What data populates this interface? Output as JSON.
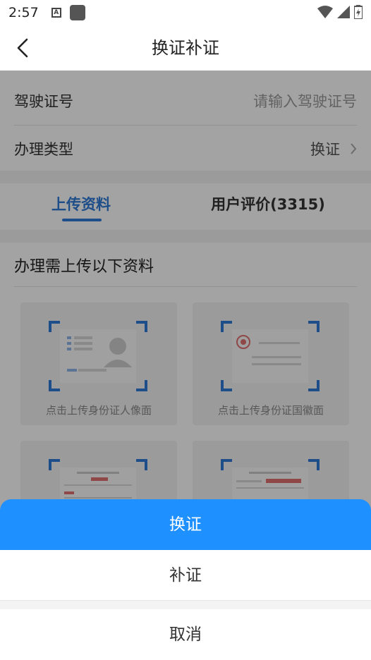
{
  "status_bar": {
    "time": "2:57",
    "notif_letter": "A"
  },
  "nav": {
    "title": "换证补证"
  },
  "form": {
    "license_label": "驾驶证号",
    "license_placeholder": "请输入驾驶证号",
    "type_label": "办理类型",
    "type_value": "换证"
  },
  "tabs": {
    "upload": "上传资料",
    "review": "用户评价(3315)"
  },
  "upload": {
    "title": "办理需上传以下资料",
    "cards": [
      {
        "caption": "点击上传身份证人像面",
        "icon": "id-portrait-icon"
      },
      {
        "caption": "点击上传身份证国徽面",
        "icon": "id-emblem-icon"
      },
      {
        "caption": "",
        "icon": "document-icon"
      },
      {
        "caption": "",
        "icon": "document-icon"
      }
    ]
  },
  "sheet": {
    "option1": "换证",
    "option2": "补证",
    "cancel": "取消"
  },
  "colors": {
    "accent": "#1e90ff",
    "tab_active": "#2f7bd8"
  }
}
